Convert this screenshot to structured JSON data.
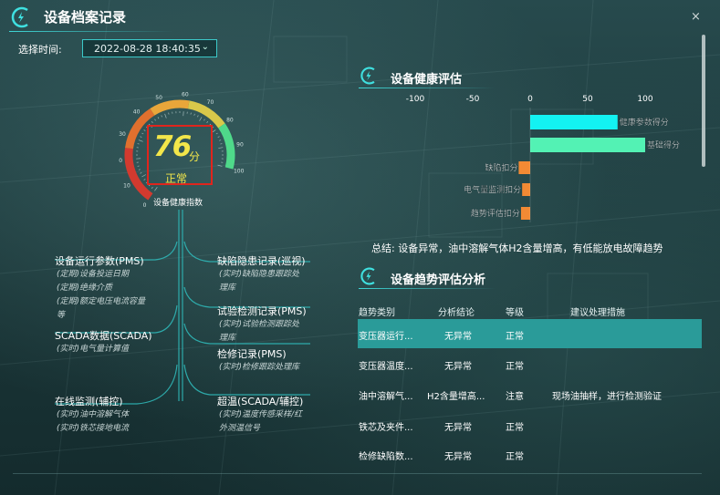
{
  "window": {
    "title": "设备档案记录",
    "close_label": "×"
  },
  "time_filter": {
    "label": "选择时间:",
    "value": "2022-08-28 18:40:35"
  },
  "gauge": {
    "value": "76",
    "unit": "分",
    "status": "正常",
    "caption": "设备健康指数",
    "level": 76,
    "ticks": [
      "0",
      "10",
      "20",
      "30",
      "40",
      "50",
      "60",
      "70",
      "80",
      "90",
      "100"
    ]
  },
  "tree": {
    "left": [
      {
        "title": "设备运行参数(PMS)",
        "subs": [
          "(定期)设备投运日期",
          "(定期)绝缘介质",
          "(定期)额定电压电流容量",
          "等"
        ]
      },
      {
        "title": "SCADA数据(SCADA)",
        "subs": [
          "(实时)电气量计算值"
        ]
      },
      {
        "title": "在线监测(辅控)",
        "subs": [
          "(实时)油中溶解气体",
          "(实时)铁芯接地电流"
        ]
      }
    ],
    "right": [
      {
        "title": "缺陷隐患记录(巡视)",
        "subs": [
          "(实时)缺陷隐患跟踪处",
          "理库"
        ]
      },
      {
        "title": "试验检测记录(PMS)",
        "subs": [
          "(实时)试验检测跟踪处",
          "理库"
        ]
      },
      {
        "title": "检修记录(PMS)",
        "subs": [
          "(实时)检修跟踪处理库"
        ]
      },
      {
        "title": "超温(SCADA/辅控)",
        "subs": [
          "(实时)温度传感采样/红",
          "外测温信号"
        ]
      }
    ]
  },
  "health": {
    "title": "设备健康评估",
    "chart_data": {
      "type": "bar",
      "orientation": "horizontal",
      "xlim": [
        -100,
        100
      ],
      "ticks": [
        "-100",
        "-50",
        "0",
        "50",
        "100"
      ],
      "categories": [
        "健康参数得分",
        "基础得分",
        "缺陷扣分",
        "电气量监测扣分",
        "趋势评估扣分"
      ],
      "values": [
        76,
        100,
        -10,
        -7,
        -8
      ],
      "colors": [
        "#13f2f2",
        "#53f2b4",
        "#f28a34",
        "#f28a34",
        "#f28a34"
      ]
    },
    "summary": "总结: 设备异常，油中溶解气体H2含量增高，有低能放电故障趋势"
  },
  "trend": {
    "title": "设备趋势评估分析",
    "columns": [
      "趋势类别",
      "分析结论",
      "等级",
      "建议处理措施"
    ],
    "rows": [
      {
        "category": "变压器运行...",
        "conclusion": "无异常",
        "level": "正常",
        "action": "",
        "selected": true
      },
      {
        "category": "变压器温度...",
        "conclusion": "无异常",
        "level": "正常",
        "action": "",
        "selected": false
      },
      {
        "category": "油中溶解气...",
        "conclusion": "H2含量增高...",
        "level": "注意",
        "action": "现场油抽样，进行检测验证",
        "selected": false
      },
      {
        "category": "铁芯及夹件...",
        "conclusion": "无异常",
        "level": "正常",
        "action": "",
        "selected": false
      },
      {
        "category": "检修缺陷数...",
        "conclusion": "无异常",
        "level": "正常",
        "action": "",
        "selected": false
      }
    ]
  }
}
